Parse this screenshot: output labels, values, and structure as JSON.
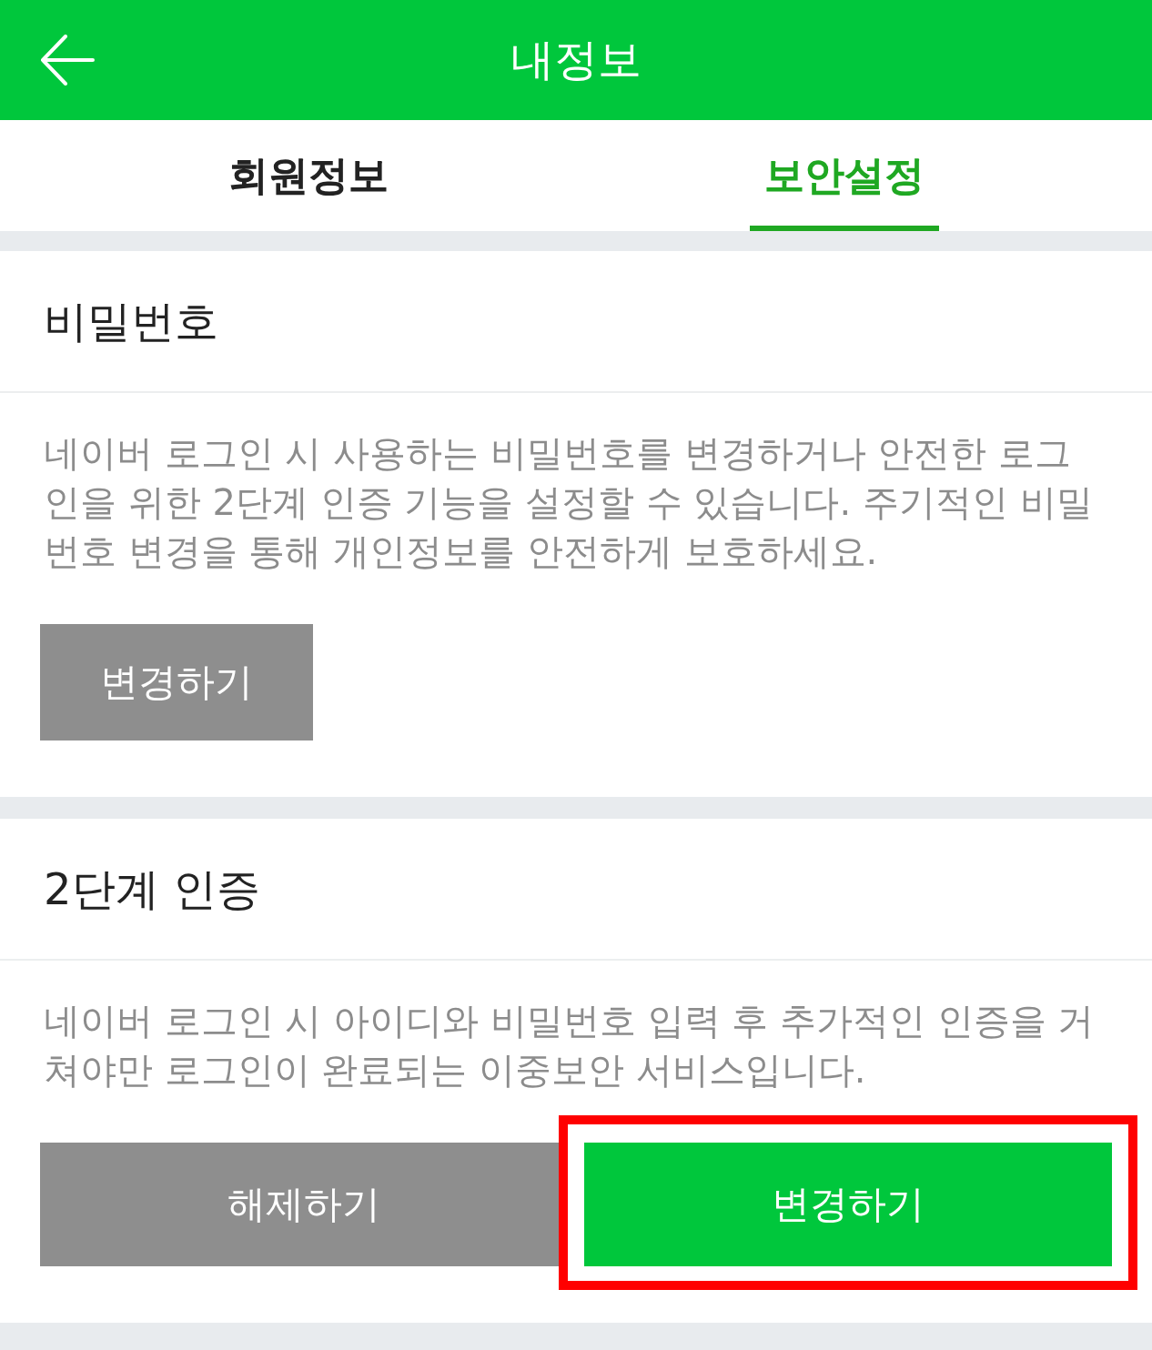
{
  "header": {
    "title": "내정보"
  },
  "tabs": [
    {
      "label": "회원정보",
      "selected": false
    },
    {
      "label": "보안설정",
      "selected": true
    }
  ],
  "sections": [
    {
      "title": "비밀번호",
      "description": "네이버 로그인 시 사용하는 비밀번호를 변경하거나 안전한 로그인을 위한 2단계 인증 기능을 설정할 수 있습니다. 주기적인 비밀번호 변경을 통해 개인정보를 안전하게 보호하세요.",
      "buttons": [
        {
          "label": "변경하기",
          "kind": "secondary",
          "highlighted": false
        }
      ]
    },
    {
      "title": "2단계 인증",
      "description": "네이버 로그인 시 아이디와 비밀번호 입력 후 추가적인 인증을 거쳐야만 로그인이 완료되는 이중보안 서비스입니다.",
      "buttons": [
        {
          "label": "해제하기",
          "kind": "secondary",
          "highlighted": false
        },
        {
          "label": "변경하기",
          "kind": "primary",
          "highlighted": true
        }
      ]
    }
  ]
}
